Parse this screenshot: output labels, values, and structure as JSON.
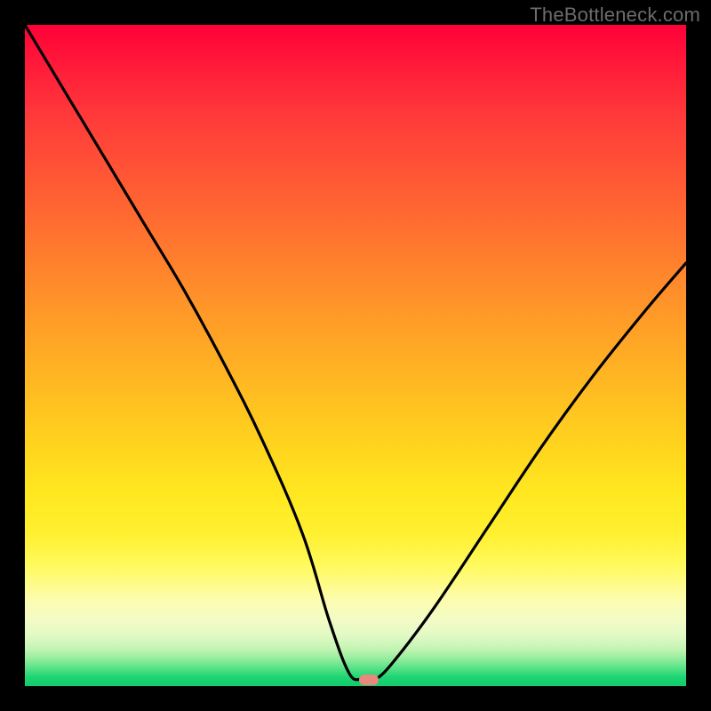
{
  "watermark": "TheBottleneck.com",
  "chart_data": {
    "type": "line",
    "title": "",
    "xlabel": "",
    "ylabel": "",
    "xlim": [
      0,
      100
    ],
    "ylim": [
      0,
      100
    ],
    "grid": false,
    "legend": false,
    "series": [
      {
        "name": "bottleneck-curve",
        "x": [
          0,
          6,
          12,
          18,
          24,
          30,
          36,
          42,
          46,
          49,
          51,
          53,
          56,
          62,
          70,
          78,
          86,
          94,
          100
        ],
        "y": [
          100,
          90,
          80,
          70,
          60,
          49,
          37,
          23,
          10,
          2,
          1,
          1,
          4,
          12,
          24,
          36,
          47,
          57,
          64
        ]
      }
    ],
    "marker": {
      "x": 52,
      "y": 1,
      "color": "#e9887e"
    },
    "background_gradient": {
      "stops": [
        {
          "pos": 0.0,
          "color": "#ff0037"
        },
        {
          "pos": 0.5,
          "color": "#ffc020"
        },
        {
          "pos": 0.8,
          "color": "#fff860"
        },
        {
          "pos": 0.95,
          "color": "#a0f0a0"
        },
        {
          "pos": 1.0,
          "color": "#13ce6d"
        }
      ]
    }
  },
  "colors": {
    "curve": "#000000",
    "frame": "#000000",
    "watermark": "#6c6c6c"
  }
}
